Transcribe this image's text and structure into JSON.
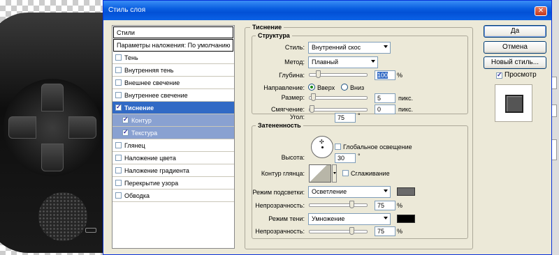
{
  "dialog": {
    "title": "Стиль слоя"
  },
  "left_panel": {
    "header": "Стили",
    "blend_options": "Параметры наложения: По умолчанию",
    "items": [
      {
        "label": "Тень",
        "checked": false
      },
      {
        "label": "Внутренняя тень",
        "checked": false
      },
      {
        "label": "Внешнее свечение",
        "checked": false
      },
      {
        "label": "Внутреннее свечение",
        "checked": false
      },
      {
        "label": "Тиснение",
        "checked": true,
        "selected": true
      },
      {
        "label": "Контур",
        "checked": true,
        "sub": true
      },
      {
        "label": "Текстура",
        "checked": true,
        "sub": true
      },
      {
        "label": "Глянец",
        "checked": false
      },
      {
        "label": "Наложение цвета",
        "checked": false
      },
      {
        "label": "Наложение градиента",
        "checked": false
      },
      {
        "label": "Перекрытие узора",
        "checked": false
      },
      {
        "label": "Обводка",
        "checked": false
      }
    ]
  },
  "emboss": {
    "section_title": "Тиснение",
    "structure": {
      "title": "Структура",
      "style_label": "Стиль:",
      "style_value": "Внутренний скос",
      "method_label": "Метод:",
      "method_value": "Плавный",
      "depth_label": "Глубина:",
      "depth_value": "100",
      "depth_unit": "%",
      "depth_level": 0.12,
      "direction_label": "Направление:",
      "dir_up": "Вверх",
      "dir_down": "Вниз",
      "size_label": "Размер:",
      "size_value": "5",
      "size_unit": "пикс.",
      "size_level": 0.03,
      "soften_label": "Смягчение:",
      "soften_value": "0",
      "soften_unit": "пикс.",
      "soften_level": 0.0
    },
    "shading": {
      "title": "Затененность",
      "angle_label": "Угол:",
      "angle_value": "75",
      "angle_unit": "°",
      "global_light": "Глобальное освещение",
      "altitude_label": "Высота:",
      "altitude_value": "30",
      "altitude_unit": "°",
      "gloss_label": "Контур глянца:",
      "antialias": "Сглаживание",
      "highlight_label": "Режим подсветки:",
      "highlight_value": "Осветление",
      "highlight_color": "#6b6b6b",
      "highlight_opacity_label": "Непрозрачность:",
      "highlight_opacity_value": "75",
      "highlight_opacity_unit": "%",
      "highlight_opacity_level": 0.75,
      "shadow_label": "Режим тени:",
      "shadow_value": "Умножение",
      "shadow_color": "#000000",
      "shadow_opacity_label": "Непрозрачность:",
      "shadow_opacity_value": "75",
      "shadow_opacity_unit": "%",
      "shadow_opacity_level": 0.75
    }
  },
  "buttons": {
    "ok": "Да",
    "cancel": "Отмена",
    "new_style": "Новый стиль...",
    "preview": "Просмотр"
  },
  "colors": {
    "selection": "#316ac5",
    "title_bar": "#0a5fe0",
    "dialog_bg": "#ece9d8"
  }
}
